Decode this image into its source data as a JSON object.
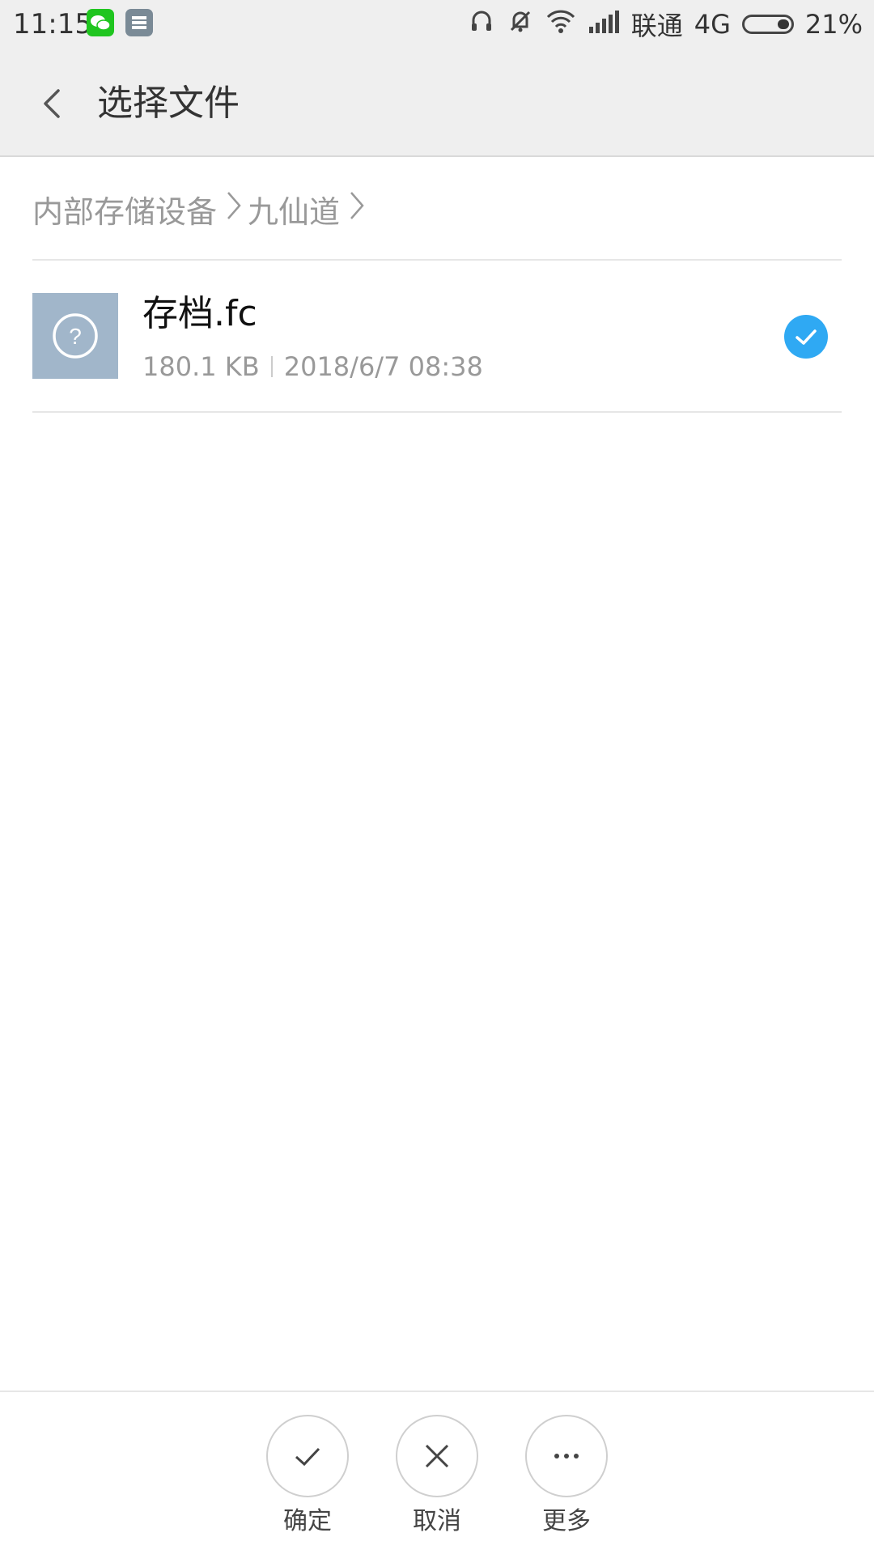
{
  "status_bar": {
    "time": "11:15",
    "carrier": "联通",
    "network": "4G",
    "battery": "21%",
    "battery_level": 0.21,
    "app_icons": [
      "wechat-icon",
      "storage-app-icon"
    ],
    "right_icons": [
      "headset-icon",
      "mute-icon",
      "wifi-icon",
      "signal-icon"
    ]
  },
  "header": {
    "title": "选择文件",
    "back_icon": "back-arrow-icon"
  },
  "breadcrumb": {
    "items": [
      "内部存储设备",
      "九仙道"
    ]
  },
  "files": [
    {
      "name": "存档.fc",
      "size": "180.1 KB",
      "date": "2018/6/7 08:38",
      "icon": "unknown-file-icon",
      "selected": true
    }
  ],
  "actions": [
    {
      "label": "确定",
      "icon": "check-icon"
    },
    {
      "label": "取消",
      "icon": "close-icon"
    },
    {
      "label": "更多",
      "icon": "more-icon"
    }
  ],
  "colors": {
    "accent": "#2fa9f3",
    "header_bg": "#efefef",
    "thumb_bg": "#a1b6ca",
    "secondary_text": "#999999"
  }
}
